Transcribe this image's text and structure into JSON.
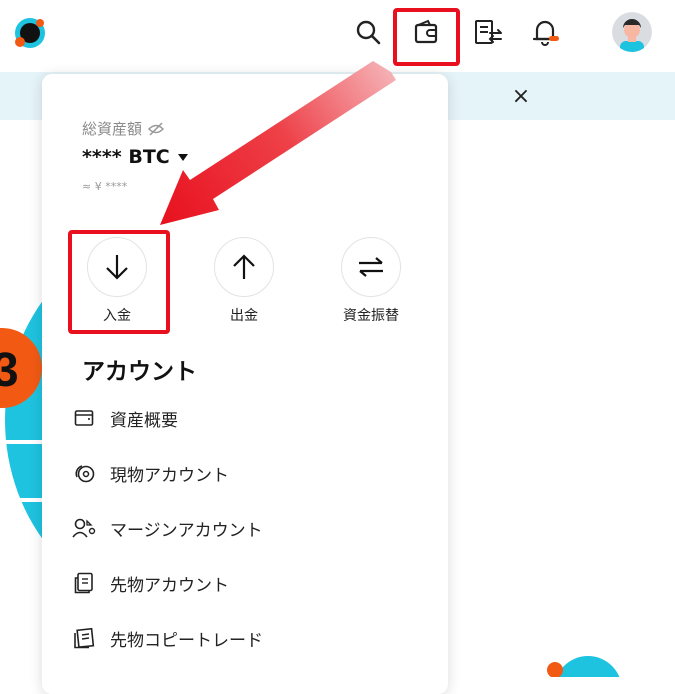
{
  "colors": {
    "accent_red": "#e8101e",
    "brand_cyan": "#1ec3e0",
    "brand_orange": "#f25a14"
  },
  "header": {
    "icons": [
      "search-icon",
      "wallet-icon",
      "orders-icon",
      "bell-icon"
    ]
  },
  "banner": {
    "close_label": "×"
  },
  "panel": {
    "total_label": "総資産額",
    "total_value": "**** BTC",
    "total_fiat": "≈ ¥ ****",
    "actions": [
      {
        "label": "入金",
        "icon": "arrow-down-icon"
      },
      {
        "label": "出金",
        "icon": "arrow-up-icon"
      },
      {
        "label": "資金振替",
        "icon": "transfer-icon"
      }
    ],
    "section_title": "アカウント",
    "menu": [
      {
        "label": "資産概要",
        "icon": "wallet-outline-icon"
      },
      {
        "label": "現物アカウント",
        "icon": "coin-icon"
      },
      {
        "label": "マージンアカウント",
        "icon": "margin-icon"
      },
      {
        "label": "先物アカウント",
        "icon": "futures-icon"
      },
      {
        "label": "先物コピートレード",
        "icon": "copy-trade-icon"
      }
    ]
  }
}
